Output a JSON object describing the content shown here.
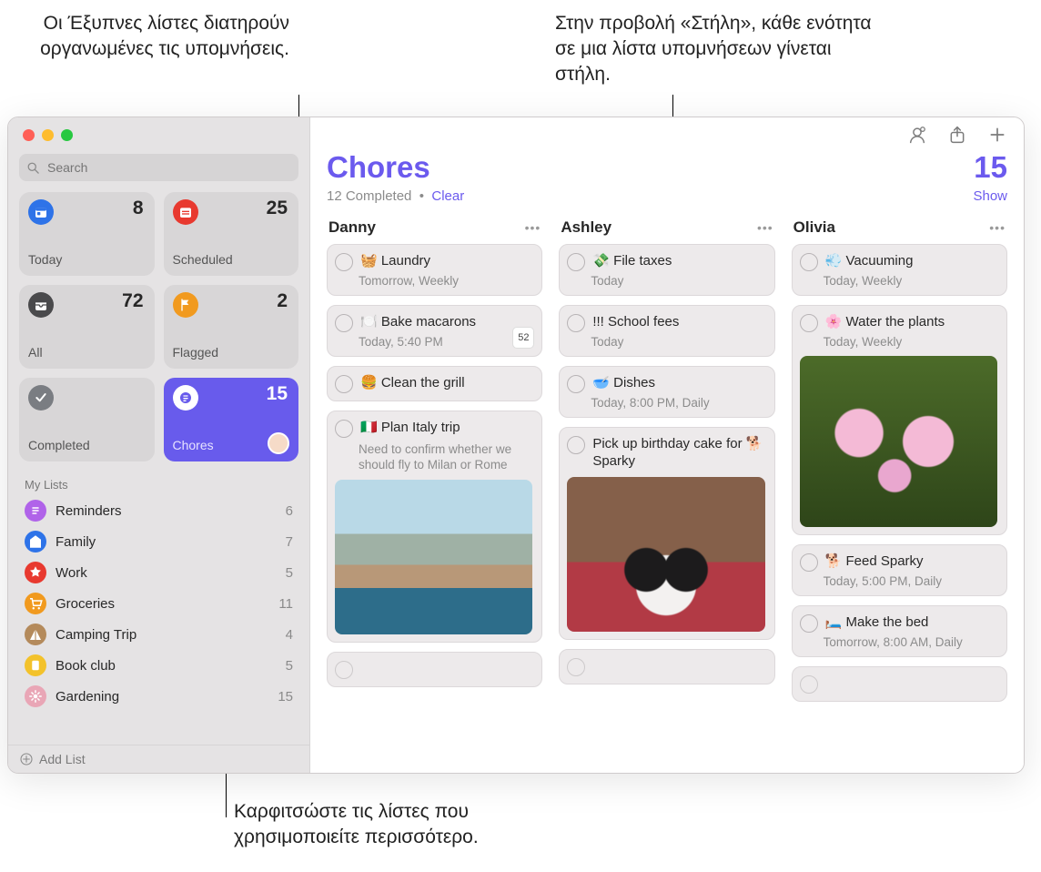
{
  "callouts": {
    "smart": "Οι Έξυπνες λίστες διατηρούν οργανωμένες τις υπομνήσεις.",
    "column": "Στην προβολή «Στήλη», κάθε ενότητα σε μια λίστα υπομνήσεων γίνεται στήλη.",
    "pin": "Καρφιτσώστε τις λίστες που χρησιμοποιείτε περισσότερο."
  },
  "search": {
    "placeholder": "Search"
  },
  "tiles": {
    "today": {
      "label": "Today",
      "count": "8",
      "color": "#2e73e8"
    },
    "scheduled": {
      "label": "Scheduled",
      "count": "25",
      "color": "#e8392f"
    },
    "all": {
      "label": "All",
      "count": "72",
      "color": "#4a4a4c"
    },
    "flagged": {
      "label": "Flagged",
      "count": "2",
      "color": "#f19a1f"
    },
    "completed": {
      "label": "Completed",
      "color": "#7a7d82"
    },
    "chores": {
      "label": "Chores",
      "count": "15",
      "color": "#ffffff"
    }
  },
  "myListsHeader": "My Lists",
  "lists": [
    {
      "name": "Reminders",
      "count": "6",
      "color": "#b063e9"
    },
    {
      "name": "Family",
      "count": "7",
      "color": "#2e73e8"
    },
    {
      "name": "Work",
      "count": "5",
      "color": "#e8392f"
    },
    {
      "name": "Groceries",
      "count": "11",
      "color": "#f19a1f"
    },
    {
      "name": "Camping Trip",
      "count": "4",
      "color": "#b48a5b"
    },
    {
      "name": "Book club",
      "count": "5",
      "color": "#f3c22b"
    },
    {
      "name": "Gardening",
      "count": "15",
      "color": "#e9a6b6"
    }
  ],
  "addList": "Add List",
  "header": {
    "title": "Chores",
    "count": "15",
    "completed": "12 Completed",
    "dot": "•",
    "clear": "Clear",
    "show": "Show"
  },
  "columns": [
    {
      "name": "Danny",
      "items": [
        {
          "title": "🧺 Laundry",
          "sub": "Tomorrow, Weekly"
        },
        {
          "title": "🍽️ Bake macarons",
          "sub": "Today, 5:40 PM",
          "calbadge": "52"
        },
        {
          "title": "🍔 Clean the grill"
        },
        {
          "title": "🇮🇹 Plan Italy trip",
          "note": "Need to confirm whether we should fly to Milan or Rome",
          "thumb": "italy"
        }
      ],
      "trailingEmpty": true
    },
    {
      "name": "Ashley",
      "items": [
        {
          "title": "💸 File taxes",
          "sub": "Today"
        },
        {
          "title": "!!! School fees",
          "sub": "Today"
        },
        {
          "title": "🥣 Dishes",
          "sub": "Today, 8:00 PM, Daily"
        },
        {
          "title": "Pick up birthday cake for 🐕 Sparky",
          "thumb": "dog"
        }
      ],
      "trailingEmpty": true
    },
    {
      "name": "Olivia",
      "items": [
        {
          "title": "💨 Vacuuming",
          "sub": "Today, Weekly"
        },
        {
          "title": "🌸 Water the plants",
          "sub": "Today, Weekly",
          "thumb": "flowers",
          "thumbTall": true
        },
        {
          "title": "🐕 Feed Sparky",
          "sub": "Today, 5:00 PM, Daily"
        },
        {
          "title": "🛏️ Make the bed",
          "sub": "Tomorrow, 8:00 AM, Daily"
        }
      ],
      "trailingEmpty": true
    }
  ]
}
